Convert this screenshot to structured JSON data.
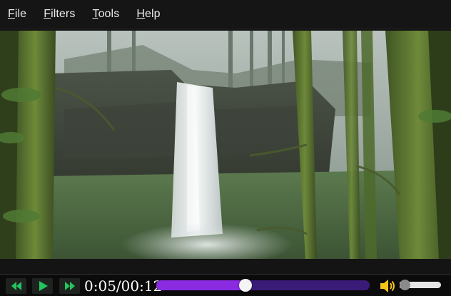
{
  "menu": {
    "items": [
      {
        "label": "File",
        "mnemonic": "F"
      },
      {
        "label": "Filters",
        "mnemonic": "F"
      },
      {
        "label": "Tools",
        "mnemonic": "T"
      },
      {
        "label": "Help",
        "mnemonic": "H"
      }
    ]
  },
  "player": {
    "time_display": "0:05/00:12",
    "progress_fraction": 0.4167,
    "volume_fraction": 0.05
  },
  "icons": {
    "rewind": "rewind-icon",
    "play": "play-icon",
    "fast_forward": "fast-forward-icon",
    "volume": "volume-icon"
  },
  "colors": {
    "accent": "#8a2be2",
    "button_icon": "#22c55e",
    "volume_icon": "#f5c518"
  }
}
